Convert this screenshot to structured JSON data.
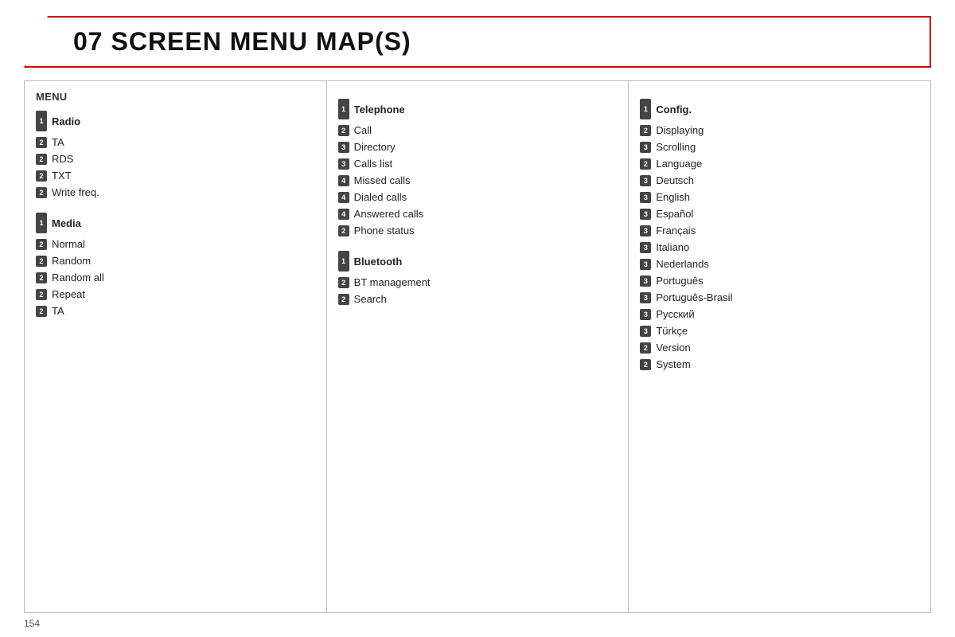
{
  "title": "07  SCREEN MENU MAP(S)",
  "page_number": "154",
  "columns": [
    {
      "header": "MENU",
      "sections": [
        {
          "level1_badge": "1",
          "level1_label": "Radio",
          "items": [
            {
              "badge": "2",
              "label": "TA"
            },
            {
              "badge": "2",
              "label": "RDS"
            },
            {
              "badge": "2",
              "label": "TXT"
            },
            {
              "badge": "2",
              "label": "Write freq."
            }
          ]
        },
        {
          "level1_badge": "1",
          "level1_label": "Media",
          "items": [
            {
              "badge": "2",
              "label": "Normal"
            },
            {
              "badge": "2",
              "label": "Random"
            },
            {
              "badge": "2",
              "label": "Random all"
            },
            {
              "badge": "2",
              "label": "Repeat"
            },
            {
              "badge": "2",
              "label": "TA"
            }
          ]
        }
      ]
    },
    {
      "header": "",
      "sections": [
        {
          "level1_badge": "1",
          "level1_label": "Telephone",
          "items": [
            {
              "badge": "2",
              "label": "Call"
            },
            {
              "badge": "3",
              "label": "Directory"
            },
            {
              "badge": "3",
              "label": "Calls list"
            },
            {
              "badge": "4",
              "label": "Missed calls"
            },
            {
              "badge": "4",
              "label": "Dialed calls"
            },
            {
              "badge": "4",
              "label": "Answered calls"
            },
            {
              "badge": "2",
              "label": "Phone status"
            }
          ]
        },
        {
          "level1_badge": "1",
          "level1_label": "Bluetooth",
          "items": [
            {
              "badge": "2",
              "label": "BT management"
            },
            {
              "badge": "2",
              "label": "Search"
            }
          ]
        }
      ]
    },
    {
      "header": "",
      "sections": [
        {
          "level1_badge": "1",
          "level1_label": "Config.",
          "items": [
            {
              "badge": "2",
              "label": "Displaying"
            },
            {
              "badge": "3",
              "label": "Scrolling"
            },
            {
              "badge": "2",
              "label": "Language"
            },
            {
              "badge": "3",
              "label": "Deutsch"
            },
            {
              "badge": "3",
              "label": "English"
            },
            {
              "badge": "3",
              "label": "Español"
            },
            {
              "badge": "3",
              "label": "Français"
            },
            {
              "badge": "3",
              "label": "Italiano"
            },
            {
              "badge": "3",
              "label": "Nederlands"
            },
            {
              "badge": "3",
              "label": "Português"
            },
            {
              "badge": "3",
              "label": "Português-Brasil"
            },
            {
              "badge": "3",
              "label": "Русский"
            },
            {
              "badge": "3",
              "label": "Türkçe"
            },
            {
              "badge": "2",
              "label": "Version"
            },
            {
              "badge": "2",
              "label": "System"
            }
          ]
        }
      ]
    }
  ]
}
